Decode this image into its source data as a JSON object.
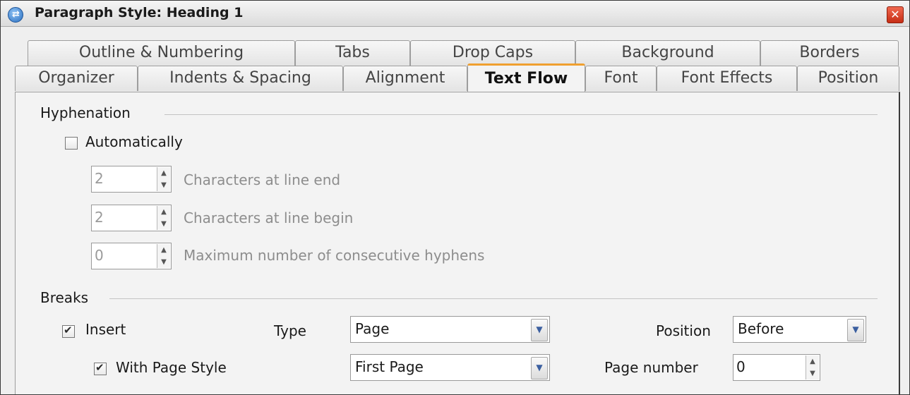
{
  "window": {
    "title": "Paragraph Style: Heading 1"
  },
  "tabs_row1": [
    "Outline & Numbering",
    "Tabs",
    "Drop Caps",
    "Background",
    "Borders"
  ],
  "tabs_row2": [
    "Organizer",
    "Indents & Spacing",
    "Alignment",
    "Text Flow",
    "Font",
    "Font Effects",
    "Position"
  ],
  "active_tab": "Text Flow",
  "hyphenation": {
    "section_label": "Hyphenation",
    "automatically": {
      "label": "Automatically",
      "checked": false
    },
    "chars_line_end": {
      "value": "2",
      "label": "Characters at line end"
    },
    "chars_line_begin": {
      "value": "2",
      "label": "Characters at line begin"
    },
    "max_hyphens": {
      "value": "0",
      "label": "Maximum number of consecutive hyphens"
    }
  },
  "breaks": {
    "section_label": "Breaks",
    "insert": {
      "label": "Insert",
      "checked": true
    },
    "type_label": "Type",
    "type_value": "Page",
    "position_label": "Position",
    "position_value": "Before",
    "with_page_style": {
      "label": "With Page Style",
      "checked": true
    },
    "page_style_value": "First Page",
    "page_number_label": "Page number",
    "page_number_value": "0"
  }
}
